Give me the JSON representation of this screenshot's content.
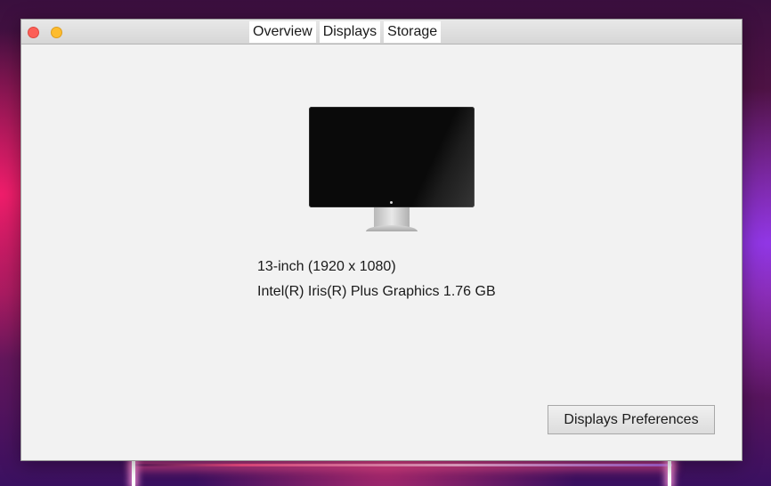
{
  "window": {
    "tabs": [
      {
        "label": "Overview"
      },
      {
        "label": "Displays"
      },
      {
        "label": "Storage"
      }
    ]
  },
  "display": {
    "icon": "monitor-icon",
    "size_resolution": "13-inch (1920 x 1080)",
    "graphics": "Intel(R) Iris(R) Plus Graphics 1.76 GB"
  },
  "actions": {
    "preferences_label": "Displays Preferences"
  },
  "colors": {
    "close": "#fc5f57",
    "minimize": "#fdbc2e",
    "window_bg": "#f2f2f2"
  }
}
